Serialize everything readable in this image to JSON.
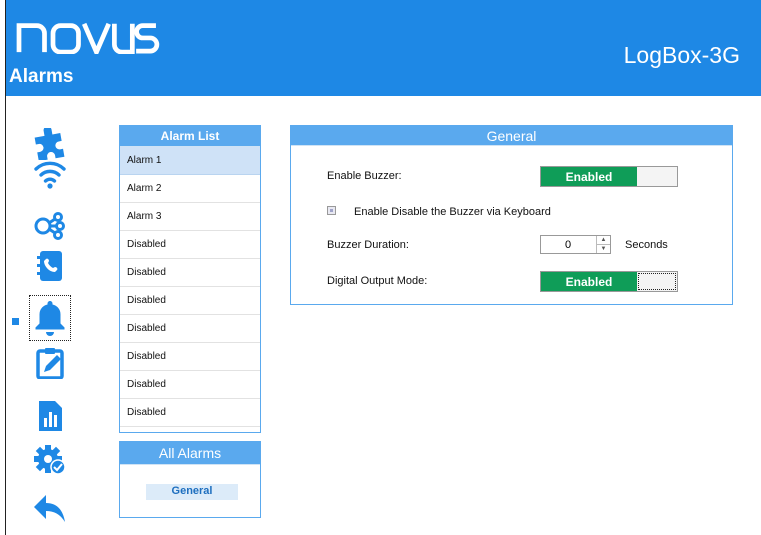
{
  "header": {
    "logo_text": "NOVUS",
    "page_title": "Alarms",
    "device_name": "LogBox-3G",
    "background_color": "#1e88e5"
  },
  "sidebar": {
    "items": [
      {
        "name": "puzzle-icon"
      },
      {
        "name": "wifi-icon"
      },
      {
        "name": "network-icon"
      },
      {
        "name": "contacts-icon"
      },
      {
        "name": "bell-icon",
        "active": true
      },
      {
        "name": "edit-icon"
      },
      {
        "name": "chart-icon"
      },
      {
        "name": "gear-check-icon"
      },
      {
        "name": "back-arrow-icon"
      }
    ]
  },
  "alarm_list": {
    "title": "Alarm List",
    "items": [
      "Alarm  1",
      "Alarm  2",
      "Alarm  3",
      "Disabled",
      "Disabled",
      "Disabled",
      "Disabled",
      "Disabled",
      "Disabled",
      "Disabled"
    ],
    "selected_index": 0
  },
  "all_alarms": {
    "title": "All Alarms",
    "general_label": "General"
  },
  "general": {
    "title": "General",
    "enable_buzzer_label": "Enable Buzzer:",
    "enable_buzzer_value": "Enabled",
    "keyboard_checkbox_label": "Enable Disable the Buzzer via Keyboard",
    "buzzer_duration_label": "Buzzer Duration:",
    "buzzer_duration_value": "0",
    "buzzer_duration_unit": "Seconds",
    "digital_output_label": "Digital Output Mode:",
    "digital_output_value": "Enabled"
  },
  "colors": {
    "accent": "#1e88e5",
    "panel_header": "#5aa9ee",
    "enabled_green": "#0f9d58"
  }
}
